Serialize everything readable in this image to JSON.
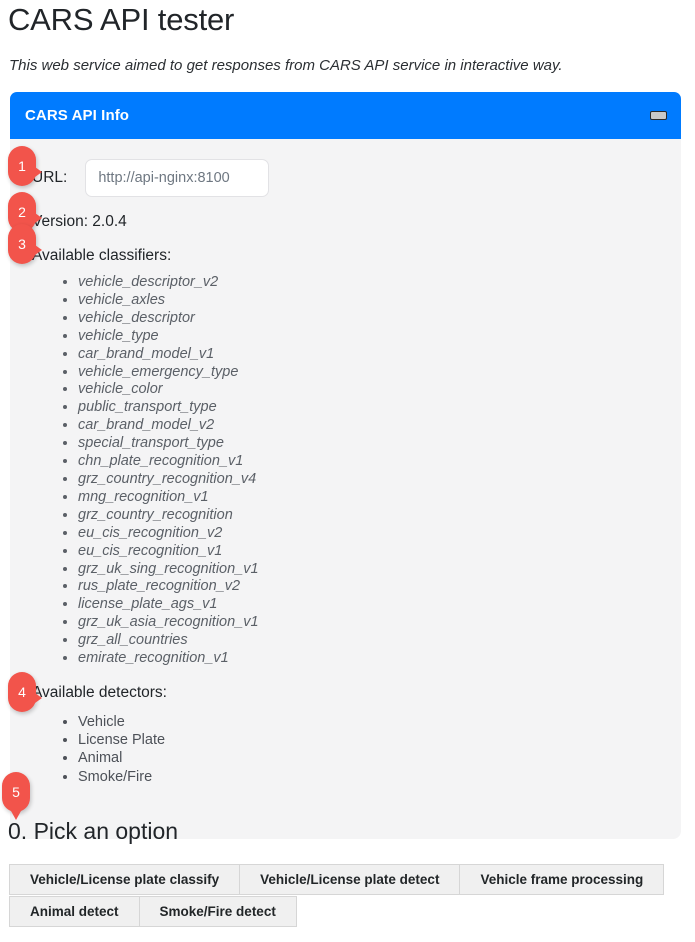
{
  "page": {
    "title": "CARS API tester",
    "subtitle": "This web service aimed to get responses from CARS API service in interactive way."
  },
  "card": {
    "header_title": "CARS API Info",
    "collapse_icon": "minimize-icon",
    "accent_color": "#007bff",
    "body_background": "#f4f4f5"
  },
  "url_field": {
    "label": "URL:",
    "value": "",
    "placeholder": "http://api-nginx:8100"
  },
  "version": {
    "text": "Version: 2.0.4",
    "label": "Version:",
    "value": "2.0.4"
  },
  "classifiers": {
    "label": "Available classifiers:",
    "items": [
      "vehicle_descriptor_v2",
      "vehicle_axles",
      "vehicle_descriptor",
      "vehicle_type",
      "car_brand_model_v1",
      "vehicle_emergency_type",
      "vehicle_color",
      "public_transport_type",
      "car_brand_model_v2",
      "special_transport_type",
      "chn_plate_recognition_v1",
      "grz_country_recognition_v4",
      "mng_recognition_v1",
      "grz_country_recognition",
      "eu_cis_recognition_v2",
      "eu_cis_recognition_v1",
      "grz_uk_sing_recognition_v1",
      "rus_plate_recognition_v2",
      "license_plate_ags_v1",
      "grz_uk_asia_recognition_v1",
      "grz_all_countries",
      "emirate_recognition_v1"
    ]
  },
  "detectors": {
    "label": "Available detectors:",
    "items": [
      "Vehicle",
      "License Plate",
      "Animal",
      "Smoke/Fire"
    ]
  },
  "markers": {
    "color": "#f2544b",
    "items": [
      "1",
      "2",
      "3",
      "4",
      "5"
    ]
  },
  "pick_option": {
    "heading": "0. Pick an option",
    "tabs": [
      "Vehicle/License plate classify",
      "Vehicle/License plate detect",
      "Vehicle frame processing",
      "Animal detect",
      "Smoke/Fire detect"
    ]
  }
}
